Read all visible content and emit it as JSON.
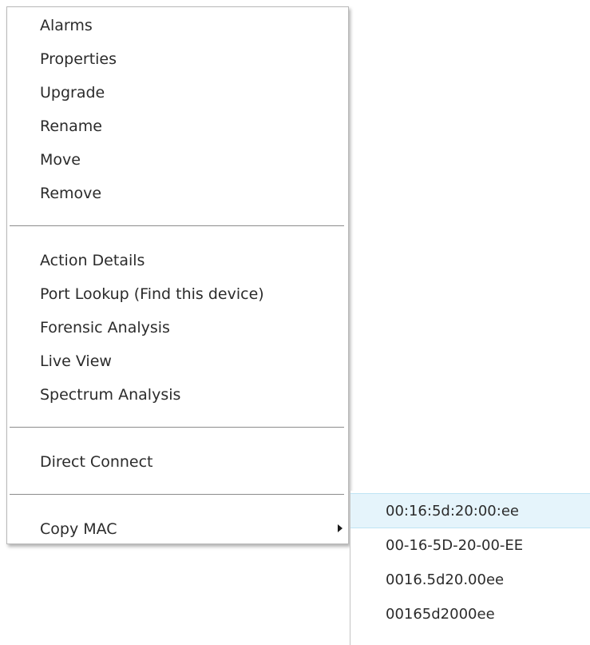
{
  "context_menu": {
    "group1": [
      "Alarms",
      "Properties",
      "Upgrade",
      "Rename",
      "Move",
      "Remove"
    ],
    "group2": [
      "Action Details",
      "Port Lookup (Find this device)",
      "Forensic Analysis",
      "Live View",
      "Spectrum Analysis"
    ],
    "group3": [
      "Direct Connect"
    ],
    "copy_mac_label": "Copy MAC"
  },
  "submenu": {
    "items": [
      "00:16:5d:20:00:ee",
      "00-16-5D-20-00-EE",
      "0016.5d20.00ee",
      "00165d2000ee"
    ],
    "highlight_color": "#e5f4fb"
  }
}
